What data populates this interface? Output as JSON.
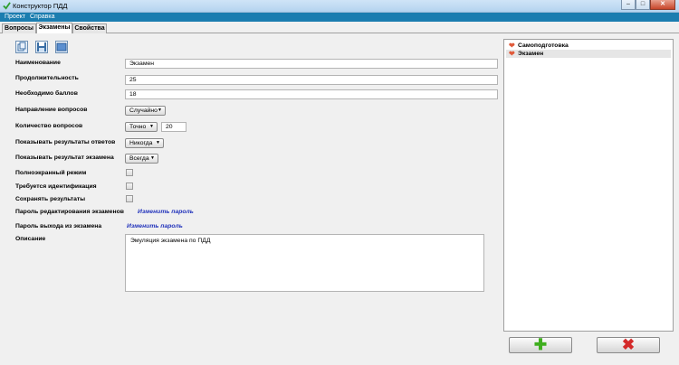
{
  "window": {
    "title": "Конструктор ПДД",
    "minimize": "–",
    "maximize": "□",
    "close": "✕"
  },
  "menu": {
    "items": [
      "Проект",
      "Справка"
    ]
  },
  "tabs": [
    "Вопросы",
    "Экзамены",
    "Свойства"
  ],
  "toolbar": {
    "icons": [
      "copy-icon",
      "save-icon",
      "window-icon"
    ]
  },
  "form": {
    "name_label": "Наименование",
    "name_value": "Экзамен",
    "duration_label": "Продолжительность",
    "duration_value": "25",
    "score_label": "Необходимо баллов",
    "score_value": "18",
    "direction_label": "Направление вопросов",
    "direction_value": "Случайно",
    "count_label": "Количество вопросов",
    "count_mode": "Точно",
    "count_value": "20",
    "answers_label": "Показывать результаты ответов",
    "answers_value": "Никогда",
    "exam_result_label": "Показывать результат экзамена",
    "exam_result_value": "Всегда",
    "fullscreen_label": "Полноэкранный режим",
    "fullscreen_checked": false,
    "ident_label": "Требуется идентификация",
    "ident_checked": false,
    "save_label": "Сохранять результаты",
    "save_checked": false,
    "edit_pass_label": "Пароль редактирования экзаменов",
    "edit_pass_link": "Изменить пароль",
    "exit_pass_label": "Пароль выхода из экзамена",
    "exit_pass_link": "Изменить пароль",
    "description_label": "Описание",
    "description_value": "Эмуляция экзамена по ПДД"
  },
  "exam_list": {
    "items": [
      {
        "label": "Самоподготовка",
        "selected": false
      },
      {
        "label": "Экзамен",
        "selected": true
      }
    ]
  },
  "buttons": {
    "add_glyph": "✚",
    "delete_glyph": "✖",
    "add_color": "#3fae1f",
    "delete_color": "#d42a2a"
  },
  "dropdown_arrow": "▼"
}
